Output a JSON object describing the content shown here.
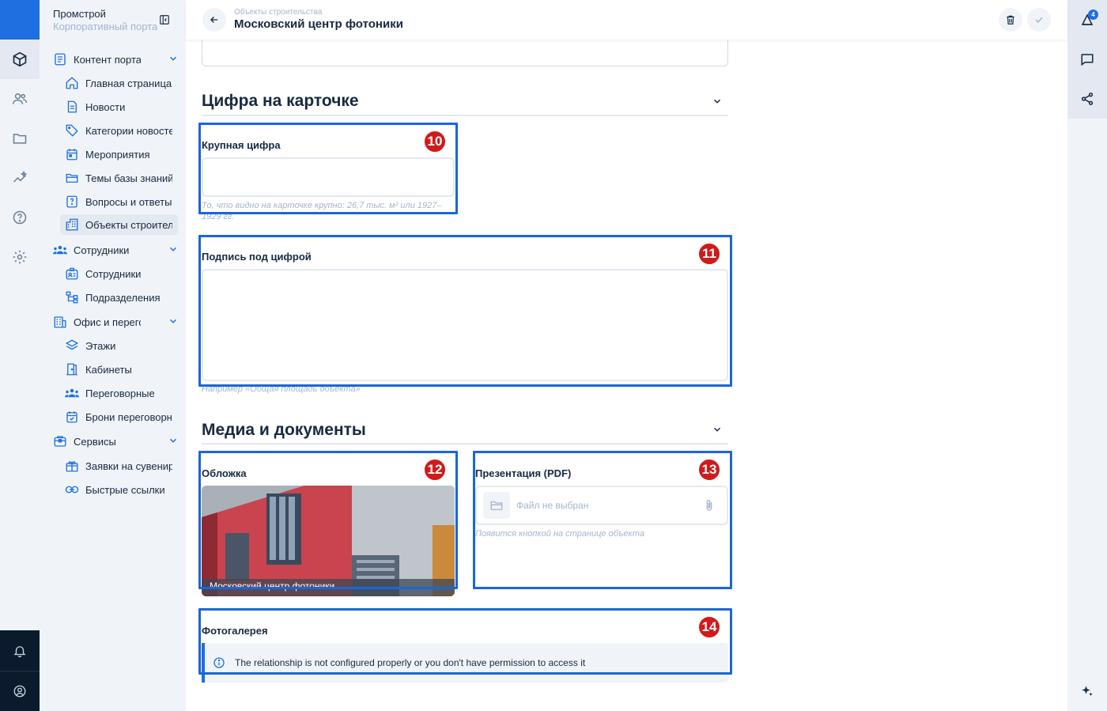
{
  "app": {
    "name": "Промстрой",
    "subtitle": "Корпоративный портал"
  },
  "header": {
    "breadcrumb": "Объекты строительства",
    "title": "Московский центр фотоники"
  },
  "notifications": {
    "count": "4"
  },
  "nav": {
    "groups": [
      {
        "label": "Контент портала",
        "icon": "document-icon",
        "items": [
          {
            "label": "Главная страница",
            "icon": "home-icon"
          },
          {
            "label": "Новости",
            "icon": "news-icon"
          },
          {
            "label": "Категории новостей",
            "icon": "tag-icon"
          },
          {
            "label": "Мероприятия",
            "icon": "calendar-icon"
          },
          {
            "label": "Темы базы знаний",
            "icon": "folder-icon"
          },
          {
            "label": "Вопросы и ответы",
            "icon": "question-icon"
          },
          {
            "label": "Объекты строительства",
            "icon": "building-icon",
            "active": true
          }
        ]
      },
      {
        "label": "Сотрудники",
        "icon": "users-icon",
        "items": [
          {
            "label": "Сотрудники",
            "icon": "id-card-icon"
          },
          {
            "label": "Подразделения",
            "icon": "org-chart-icon"
          }
        ]
      },
      {
        "label": "Офис и переговорные",
        "icon": "office-icon",
        "items": [
          {
            "label": "Этажи",
            "icon": "layers-icon"
          },
          {
            "label": "Кабинеты",
            "icon": "door-icon"
          },
          {
            "label": "Переговорные",
            "icon": "group-icon"
          },
          {
            "label": "Брони переговорных",
            "icon": "calendar-check-icon"
          }
        ]
      },
      {
        "label": "Сервисы",
        "icon": "services-icon",
        "items": [
          {
            "label": "Заявки на сувениры",
            "icon": "gift-icon"
          },
          {
            "label": "Быстрые ссылки",
            "icon": "link-icon"
          }
        ]
      }
    ]
  },
  "form": {
    "section_number": {
      "title": "Цифра на карточке",
      "big_number": {
        "label": "Крупная цифра",
        "value": "",
        "hint": "То, что видно на карточке крупно: 26,7 тыс. м² или 1927–1929 гг."
      },
      "caption": {
        "label": "Подпись под цифрой",
        "value": "",
        "hint": "Например «Общая площадь объекта»"
      }
    },
    "section_media": {
      "title": "Медиа и документы",
      "cover": {
        "label": "Обложка",
        "caption": "Московский центр фотоники"
      },
      "presentation": {
        "label": "Презентация (PDF)",
        "placeholder": "Файл не выбран",
        "hint": "Появится кнопкой на странице объекта"
      },
      "gallery": {
        "label": "Фотогалерея",
        "notice": "The relationship is not configured properly or you don't have permission to access it"
      }
    }
  },
  "annotations": [
    "10",
    "11",
    "12",
    "13",
    "14"
  ],
  "colors": {
    "accent": "#1f6fe0",
    "highlight": "#1a66d9",
    "marker": "#d21a1a"
  }
}
